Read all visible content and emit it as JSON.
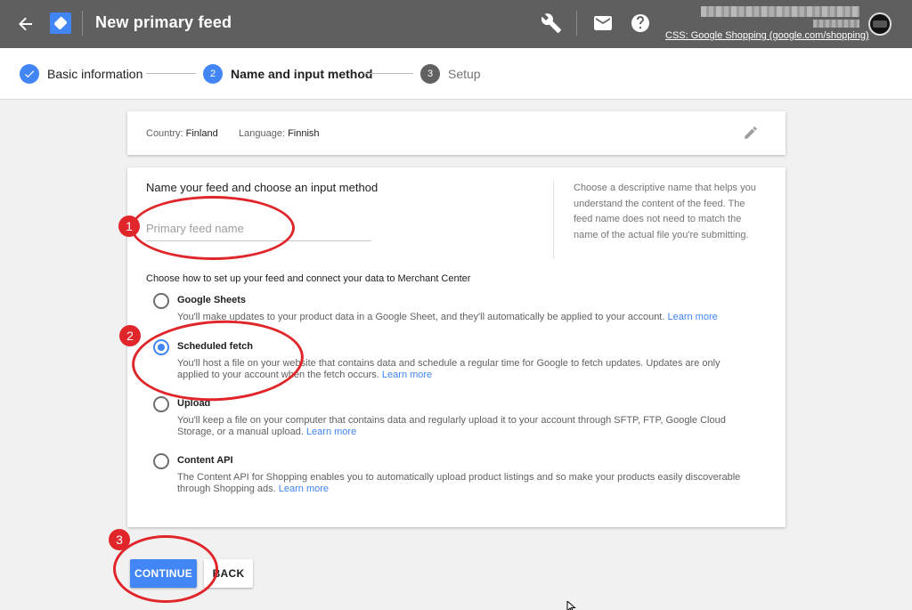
{
  "header": {
    "title": "New primary feed",
    "account_subtitle": "CSS: Google Shopping (google.com/shopping)",
    "colors": {
      "bar": "#5f5f5f",
      "accent": "#4285f4"
    }
  },
  "stepper": {
    "steps": [
      {
        "number": "",
        "label": "Basic information",
        "state": "done"
      },
      {
        "number": "2",
        "label": "Name and input method",
        "state": "active"
      },
      {
        "number": "3",
        "label": "Setup",
        "state": "upcoming"
      }
    ]
  },
  "country_card": {
    "country_label": "Country:",
    "country_value": "Finland",
    "language_label": "Language:",
    "language_value": "Finnish"
  },
  "form": {
    "section_title": "Name your feed and choose an input method",
    "name_placeholder": "Primary feed name",
    "name_value": "",
    "help_text": "Choose a descriptive name that helps you understand the content of the feed. The feed name does not need to match the name of the actual file you're submitting.",
    "choose_label": "Choose how to set up your feed and connect your data to Merchant Center",
    "options": [
      {
        "title": "Google Sheets",
        "desc": "You'll make updates to your product data in a Google Sheet, and they'll automatically be applied to your account.",
        "link": "Learn more",
        "selected": false
      },
      {
        "title": "Scheduled fetch",
        "desc": "You'll host a file on your website that contains data and schedule a regular time for Google to fetch updates. Updates are only applied to your account when the fetch occurs.",
        "link": "Learn more",
        "selected": true
      },
      {
        "title": "Upload",
        "desc": "You'll keep a file on your computer that contains data and regularly upload it to your account through SFTP, FTP, Google Cloud Storage, or a manual upload.",
        "link": "Learn more",
        "selected": false
      },
      {
        "title": "Content API",
        "desc": "The Content API for Shopping enables you to automatically upload product listings and so make your products easily discoverable through Shopping ads.",
        "link": "Learn more",
        "selected": false
      }
    ]
  },
  "buttons": {
    "continue_label": "CONTINUE",
    "back_label": "BACK"
  },
  "annotations": {
    "badges": [
      "1",
      "2",
      "3"
    ],
    "color": "#e0262b"
  }
}
